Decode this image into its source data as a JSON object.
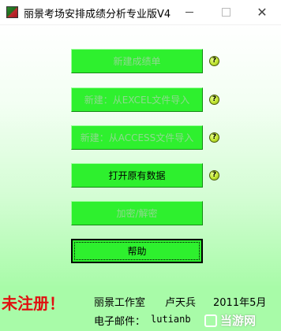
{
  "window": {
    "title": "丽景考场安排成绩分析专业版V4.",
    "controls": {
      "minimize": "minimize-icon",
      "maximize": "maximize-icon",
      "close": "close-icon"
    }
  },
  "buttons": [
    {
      "label": "新建成绩单",
      "enabled": false,
      "help_icon": true
    },
    {
      "label": "新建：从EXCEL文件导入",
      "enabled": false,
      "help_icon": true
    },
    {
      "label": "新建：从ACCESS文件导入",
      "enabled": false,
      "help_icon": true
    },
    {
      "label": "打开原有数据",
      "enabled": true,
      "help_icon": true
    },
    {
      "label": "加密/解密",
      "enabled": false,
      "help_icon": false
    },
    {
      "label": "帮助",
      "enabled": true,
      "help_icon": false
    }
  ],
  "help_icon_glyph": "?",
  "footer": {
    "registration_status": "未注册！",
    "studio": "丽景工作室",
    "author": "卢天兵",
    "date": "2011年5月",
    "email_label": "电子邮件：",
    "email_value": "lutianb"
  },
  "watermark": "当游网",
  "colors": {
    "button_fill": "#2ef02e",
    "disabled_text": "#8fd98f",
    "background_bottom": "#a8fba8",
    "warning_red": "#e01010"
  }
}
